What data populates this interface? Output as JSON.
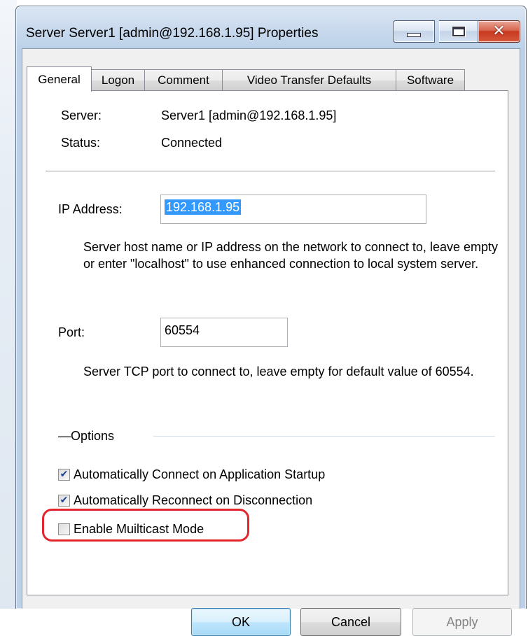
{
  "window": {
    "title": "Server Server1 [admin@192.168.1.95] Properties",
    "close_symbol": "✕"
  },
  "tabs": [
    "General",
    "Logon",
    "Comment",
    "Video Transfer Defaults",
    "Software"
  ],
  "active_tab": "General",
  "general": {
    "server_label": "Server:",
    "server_value": "Server1 [admin@192.168.1.95]",
    "status_label": "Status:",
    "status_value": "Connected",
    "ip_label": "IP Address:",
    "ip_value": "192.168.1.95",
    "ip_description": "Server host name or IP address on the network to connect to, leave empty or enter \"localhost\" to use enhanced connection to local system server.",
    "port_label": "Port:",
    "port_value": "60554",
    "port_description": "Server TCP port to connect to, leave empty for default value of 60554.",
    "options_label": "Options",
    "options": [
      {
        "label": "Automatically Connect on Application Startup",
        "checked": true
      },
      {
        "label": "Automatically Reconnect on Disconnection",
        "checked": true
      },
      {
        "label": "Enable Muilticast Mode",
        "checked": false
      }
    ],
    "check_mark": "✔"
  },
  "buttons": {
    "ok": "OK",
    "cancel": "Cancel",
    "apply": "Apply"
  },
  "colors": {
    "highlight": "#e3262b",
    "selection": "#3399ff",
    "check": "#1b3f8c"
  },
  "icons": {
    "minimize": "minimize-icon",
    "maximize": "maximize-icon",
    "close": "close-icon",
    "checkbox": "checkbox-icon"
  }
}
